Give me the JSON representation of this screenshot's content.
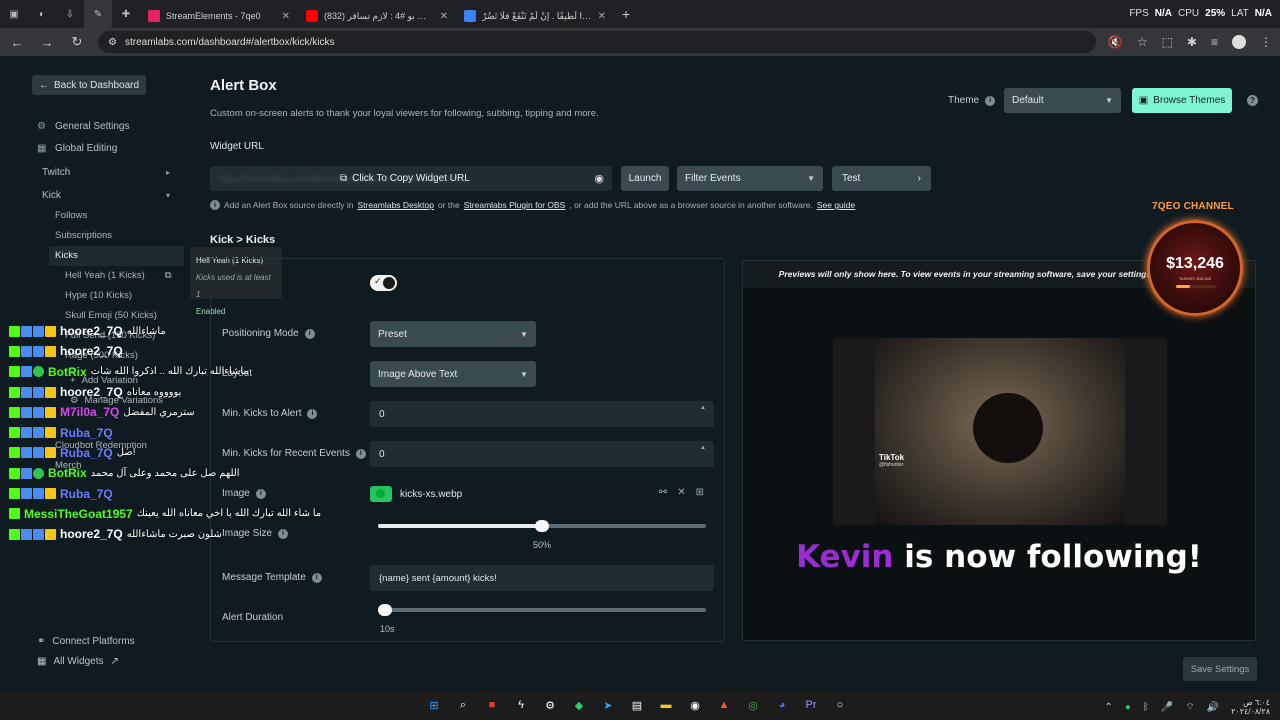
{
  "browser": {
    "tabs": [
      {
        "label": "StreamElements - 7qe0",
        "color": "#e91e63"
      },
      {
        "label": "(832) باص تي بو #4 : لازم تسافر ...",
        "color": "#ff0000"
      },
      {
        "label": "كُنْ غائِرًا لَطيفًا . إنْ لَمْ تَنْفَعْ فلَا تَضُرْ",
        "color": "#3b82f6"
      }
    ],
    "new_tab": "+",
    "stats": {
      "fps_label": "FPS",
      "fps_value": "N/A",
      "cpu_label": "CPU",
      "cpu_value": "25%",
      "lat_label": "LAT",
      "lat_value": "N/A"
    },
    "url": "streamlabs.com/dashboard#/alertbox/kick/kicks"
  },
  "sidebar": {
    "back_label": "Back to Dashboard",
    "items": [
      {
        "label": "General Settings",
        "icon": "gear-icon"
      },
      {
        "label": "Global Editing",
        "icon": "grid-icon"
      },
      {
        "label": "Twitch"
      },
      {
        "label": "Kick"
      }
    ],
    "kick_sub": [
      "Follows",
      "Subscriptions",
      "Kicks"
    ],
    "variations": [
      "Hell Yeah (1 Kicks)",
      "Hype (10 Kicks)",
      "Skull Emoji (50 Kicks)",
      "Full Send (100 Kicks)",
      "Rage (500 Kicks)"
    ],
    "add_variation": "Add Variation",
    "manage_variations": "Manage Variations",
    "misc_items": [
      "Cloudbot Redemption",
      "Merch"
    ],
    "connect_platforms": "Connect Platforms",
    "all_widgets": "All Widgets"
  },
  "tooltip": {
    "title": "Hell Yeah (1 Kicks)",
    "condition": "Kicks used is at least 1",
    "status": "Enabled"
  },
  "main": {
    "title": "Alert Box",
    "description": "Custom on-screen alerts to thank your loyal viewers for following, subbing, tipping and more.",
    "theme_label": "Theme",
    "theme_value": "Default",
    "browse_themes": "Browse Themes",
    "widget_url_label": "Widget URL",
    "widget_url_masked": "https://streamlabs.com/alert-box/v3/xxxxxxxxxxxxxxxxxxxxxxxx",
    "copy_label": "Click To Copy Widget URL",
    "launch": "Launch",
    "filter_events": "Filter Events",
    "test": "Test",
    "hint_prefix": "Add an Alert Box source directly in",
    "hint_link1": "Streamlabs Desktop",
    "hint_or": "or the",
    "hint_link2": "Streamlabs Plugin for OBS",
    "hint_mid": ", or add the URL above as a browser source in another software.",
    "hint_link3": "See guide",
    "breadcrumb_1": "Kick",
    "breadcrumb_sep": ">",
    "breadcrumb_2": "Kicks"
  },
  "form": {
    "positioning_label": "Positioning Mode",
    "positioning_value": "Preset",
    "layout_label": "Layout",
    "layout_value": "Image Above Text",
    "min_alert_label": "Min. Kicks to Alert",
    "min_alert_value": "0",
    "min_recent_label": "Min. Kicks for Recent Events",
    "min_recent_value": "0",
    "image_label": "Image",
    "image_file": "kicks-xs.webp",
    "image_size_label": "Image Size",
    "image_size_value": "50%",
    "image_size_fraction": 0.5,
    "template_label": "Message Template",
    "template_value": "{name} sent {amount} kicks!",
    "duration_label": "Alert Duration",
    "duration_value": "10s",
    "duration_fraction": 0.02
  },
  "preview": {
    "note": "Previews will only show here. To view events in your streaming software, save your settings then click the \"T",
    "tiktok": "TikTok",
    "tiktok_user": "@fishunter",
    "alert_name": "Kevin",
    "alert_text": " is now following!"
  },
  "save_settings": "Save Settings",
  "overlay": {
    "channel": "7QEO CHANNEL",
    "amount": "$13,246",
    "target": "TARGET: $15,000",
    "progress": 0.35
  },
  "chat": [
    {
      "name": "hoore2_7Q",
      "color": "#ffffff",
      "msg": "ماشاءالله",
      "badges": [
        "k",
        "p",
        "p",
        "c"
      ]
    },
    {
      "name": "hoore2_7Q",
      "color": "#ffffff",
      "msg": "",
      "badges": [
        "k",
        "p",
        "p",
        "c"
      ]
    },
    {
      "name": "BotRix",
      "color": "#53fc18",
      "msg": "ماشاءالله تبارك الله .. اذكروا الله شات",
      "badges": [
        "k",
        "p",
        "bot"
      ]
    },
    {
      "name": "hoore2_7Q",
      "color": "#ffffff",
      "msg": "يووووه معاناه",
      "badges": [
        "k",
        "p",
        "p",
        "c"
      ]
    },
    {
      "name": "M7il0a_7Q",
      "color": "#d946ef",
      "msg": "سترمري المفضل",
      "badges": [
        "k",
        "p",
        "p",
        "c"
      ]
    },
    {
      "name": "Ruba_7Q",
      "color": "#6b7cff",
      "msg": "",
      "badges": [
        "k",
        "p",
        "p",
        "c"
      ]
    },
    {
      "name": "Ruba_7Q",
      "color": "#6b7cff",
      "msg": "صل!",
      "badges": [
        "k",
        "p",
        "p",
        "c"
      ]
    },
    {
      "name": "BotRix",
      "color": "#53fc18",
      "msg": "اللهم صل على محمد وعلى آل محمد",
      "badges": [
        "k",
        "p",
        "bot"
      ]
    },
    {
      "name": "Ruba_7Q",
      "color": "#6b7cff",
      "msg": "",
      "badges": [
        "k",
        "p",
        "p",
        "c"
      ]
    },
    {
      "name": "MessiTheGoat1957",
      "color": "#53fc18",
      "msg": "ما شاء الله تبارك الله يا اخي معاناه الله يعينك",
      "badges": [
        "k"
      ]
    },
    {
      "name": "hoore2_7Q",
      "color": "#ffffff",
      "msg": "شلون صبرت ماشاءالله",
      "badges": [
        "k",
        "p",
        "p",
        "c"
      ]
    }
  ],
  "taskbar": {
    "icons": [
      "windows-icon",
      "search-icon",
      "app-red-icon",
      "app-bolt-icon",
      "settings-icon",
      "app-green-icon",
      "app-telegram-icon",
      "notes-icon",
      "folder-icon",
      "obs-icon",
      "brave-icon",
      "chrome-icon",
      "discord-icon",
      "premiere-icon",
      "app-circle-icon"
    ],
    "time": "٦:٠٤ ص",
    "date": "٢٠٢٤/٠٨/٢٨"
  }
}
